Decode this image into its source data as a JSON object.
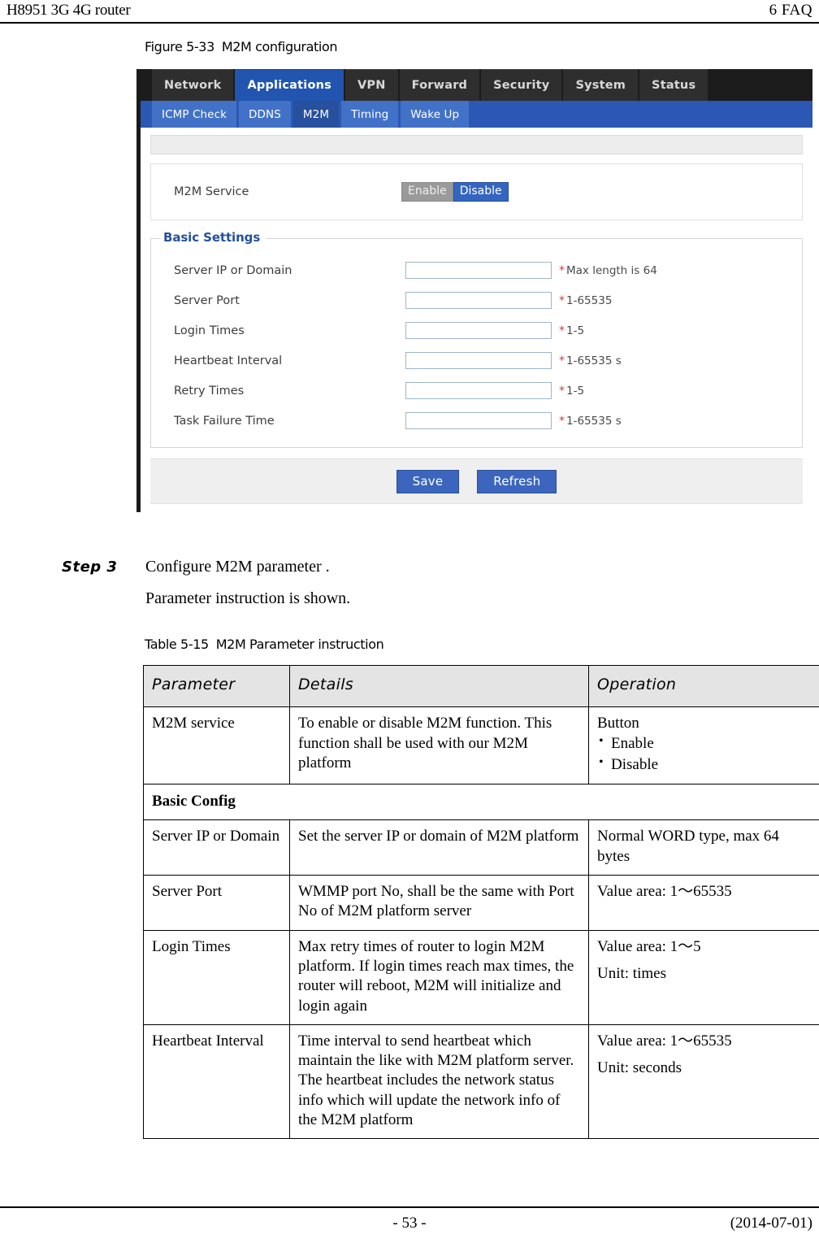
{
  "header": {
    "left": "H8951 3G 4G router",
    "right": "6  FAQ"
  },
  "figure": {
    "caption_number": "Figure 5-33",
    "caption_text": "M2M configuration"
  },
  "router_ui": {
    "main_tabs": [
      {
        "label": "Network",
        "active": false
      },
      {
        "label": "Applications",
        "active": true
      },
      {
        "label": "VPN",
        "active": false
      },
      {
        "label": "Forward",
        "active": false
      },
      {
        "label": "Security",
        "active": false
      },
      {
        "label": "System",
        "active": false
      },
      {
        "label": "Status",
        "active": false
      }
    ],
    "sub_tabs": [
      {
        "label": "ICMP Check",
        "active": false
      },
      {
        "label": "DDNS",
        "active": false
      },
      {
        "label": "M2M",
        "active": true
      },
      {
        "label": "Timing",
        "active": false
      },
      {
        "label": "Wake Up",
        "active": false
      }
    ],
    "service": {
      "label": "M2M Service",
      "enable_label": "Enable",
      "disable_label": "Disable",
      "selected": "Disable"
    },
    "basic_settings": {
      "legend": "Basic Settings",
      "fields": [
        {
          "label": "Server IP or Domain",
          "value": "",
          "hint": "Max length is 64"
        },
        {
          "label": "Server Port",
          "value": "",
          "hint": "1-65535"
        },
        {
          "label": "Login Times",
          "value": "",
          "hint": "1-5"
        },
        {
          "label": "Heartbeat Interval",
          "value": "",
          "hint": "1-65535 s"
        },
        {
          "label": "Retry Times",
          "value": "",
          "hint": "1-5"
        },
        {
          "label": "Task Failure Time",
          "value": "",
          "hint": "1-65535 s"
        }
      ],
      "required_marker": "*"
    },
    "actions": {
      "save_label": "Save",
      "refresh_label": "Refresh"
    },
    "accent_color": "#2a58b4",
    "legend_color": "#24519e",
    "required_color": "#d23a3a"
  },
  "step": {
    "label": "Step 3",
    "text": "Configure M2M parameter .",
    "subtext": "Parameter instruction is shown."
  },
  "table": {
    "caption_number": "Table 5-15",
    "caption_text": "M2M Parameter instruction",
    "columns": [
      "Parameter",
      "Details",
      "Operation"
    ],
    "rows": [
      {
        "type": "data",
        "parameter": "M2M service",
        "details": "To enable or disable M2M function. This function shall be used with our M2M platform",
        "operation_heading": "Button",
        "operation_list": [
          "Enable",
          "Disable"
        ]
      },
      {
        "type": "section",
        "title": "Basic Config"
      },
      {
        "type": "data",
        "parameter": "Server IP or Domain",
        "details": "Set the server IP or domain of M2M platform",
        "operation": "Normal WORD type, max 64 bytes"
      },
      {
        "type": "data",
        "parameter": "Server Port",
        "details": "WMMP port No, shall be the same with Port No of M2M platform server",
        "operation": "Value area: 1～65535"
      },
      {
        "type": "data",
        "parameter": "Login Times",
        "details": "Max retry times of router to login M2M platform. If login times reach max times, the router will reboot, M2M will initialize and login again",
        "operation": "Value area: 1～5",
        "operation_extra": "Unit: times"
      },
      {
        "type": "data",
        "parameter": "Heartbeat Interval",
        "details": "Time interval to send heartbeat which maintain the like with M2M platform server. The heartbeat includes the network status info which will update the network info of the M2M platform",
        "operation": "Value area: 1～65535",
        "operation_extra": "Unit: seconds"
      }
    ]
  },
  "footer": {
    "page_number": "- 53 -",
    "date": "(2014-07-01)"
  }
}
